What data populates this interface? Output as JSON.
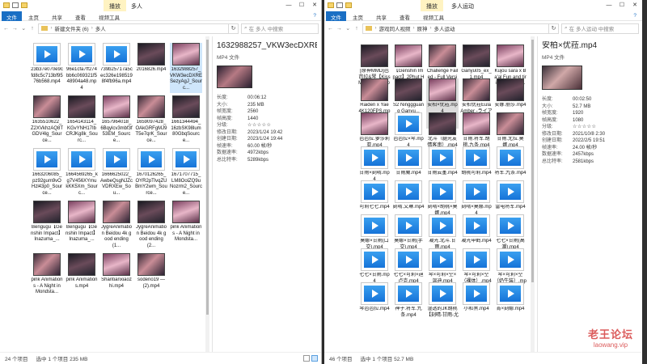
{
  "left_window": {
    "context_tab": "播放",
    "title": "多人",
    "ribbon": [
      "文件",
      "主页",
      "共享",
      "查看",
      "视频工具"
    ],
    "breadcrumb": [
      "新建文件夹 (6)",
      "多人"
    ],
    "search_placeholder": "在 多人 中搜索",
    "files": [
      {
        "name": "23b37e070e9cfd8c5c713bf9576b568.mp4",
        "kind": "video"
      },
      {
        "name": "96e1cfa7ff274bb6c069321f548904a48.mp4",
        "kind": "video"
      },
      {
        "name": "739b25717a5cec326e1985198f4fb96a.mp4",
        "kind": "video"
      },
      {
        "name": "2016826.mp4",
        "kind": "img"
      },
      {
        "name": "1632988257_VKW3ecDXRESezyAgJ_Sourc...",
        "kind": "img",
        "selected": true
      },
      {
        "name": "1635510622_Z2XVkhzAQ8TGDV4lg_Source...",
        "kind": "img"
      },
      {
        "name": "1654143114_KGvYNH17IbCRJKg8k_Sourc...",
        "kind": "img"
      },
      {
        "name": "1657964018_6Bqylcv3mbf3f53EM_Source...",
        "kind": "img"
      },
      {
        "name": "1659097428_OAkGRFgMJ9T5e7qrK_Source...",
        "kind": "img"
      },
      {
        "name": "1661344494_16zbSK98lum80GbqSource...",
        "kind": "img"
      },
      {
        "name": "1663206085_pz92gum9vOHzl43p0_Source...",
        "kind": "video"
      },
      {
        "name": "1664569265_kg7V456XYmukKK5Xm_Sourc...",
        "kind": "video"
      },
      {
        "name": "1666625022_AwbeQsgNJZcVDRXEw_Sou...",
        "kind": "video"
      },
      {
        "name": "1670126265_OYR2pTlvqZUBmY2wm_Source...",
        "kind": "video"
      },
      {
        "name": "1671707715_LM8OolZQ9uNozrm2_Source...",
        "kind": "video"
      },
      {
        "name": "Bengugu【Genshin Impact】Inazuma_...",
        "kind": "img"
      },
      {
        "name": "Bengugu【Genshin Impact】Inazuma_...",
        "kind": "img"
      },
      {
        "name": "JygreAnimation Beidou 4k good ending (1...",
        "kind": "img"
      },
      {
        "name": "JygreAnimation Beidou 4k good ending (2...",
        "kind": "img"
      },
      {
        "name": "pink Animations - A Night in Mondsta...",
        "kind": "img"
      },
      {
        "name": "pink Animations - A Night in Mondsta...",
        "kind": "img"
      },
      {
        "name": "pink Animations.mp4",
        "kind": "img"
      },
      {
        "name": "Shantianxiaozhi.mp4",
        "kind": "img"
      },
      {
        "name": "sodeno19 — (2).mp4",
        "kind": "img"
      }
    ],
    "preview": {
      "title": "1632988257_VKW3ecDXRE...",
      "type": "MP4 文件",
      "props": [
        {
          "k": "长度:",
          "v": "00:06:12"
        },
        {
          "k": "大小:",
          "v": "235 MB"
        },
        {
          "k": "帧宽度:",
          "v": "2560"
        },
        {
          "k": "帧高度:",
          "v": "1440"
        },
        {
          "k": "分级:",
          "v": "☆☆☆☆☆"
        },
        {
          "k": "修改日期:",
          "v": "2023/1/24 19:42"
        },
        {
          "k": "创建日期:",
          "v": "2023/1/24 19:44"
        },
        {
          "k": "帧速率:",
          "v": "60.00 帧/秒"
        },
        {
          "k": "数据速率:",
          "v": "4972kbps"
        },
        {
          "k": "总比特率:",
          "v": "5289kbps"
        }
      ]
    },
    "status": {
      "count": "24 个项目",
      "selected": "选中 1 个项目  235 MB"
    }
  },
  "right_window": {
    "context_tab": "播放",
    "title": "多人运动",
    "ribbon": [
      "文件",
      "主页",
      "共享",
      "查看",
      "视频工具"
    ],
    "breadcrumb": [
      "游戏同人视频",
      "原神",
      "多人运动"
    ],
    "search_placeholder": "在 多人运动 中搜索",
    "files": [
      {
        "name": "[原神MMD]芭芭拉&琴【KissMe爱して るって】",
        "kind": "img"
      },
      {
        "name": "【Genshin Impact】2Phut Hon_4K...",
        "kind": "img"
      },
      {
        "name": "Challenge Failed - Full Version_...",
        "kind": "img"
      },
      {
        "name": "Ganyu05_ex_1.mp4",
        "kind": "img"
      },
      {
        "name": "Kujou sara x Ba'al Fun and tiring gift (HD)...",
        "kind": "img"
      },
      {
        "name": "Raiden x Yae 4K120FPS.mp4",
        "kind": "img"
      },
      {
        "name": "S2 Ninggguang Ganyu...",
        "kind": "img"
      },
      {
        "name": "安柏×优菈.mp4",
        "kind": "img",
        "selected": true
      },
      {
        "name": "安柏优菈Eula Amber -ライアーダ...",
        "kind": "img"
      },
      {
        "name": "安娜.丽莎.mp4",
        "kind": "img"
      },
      {
        "name": "芭芭拉.萝莎莉亚.mp4",
        "kind": "img"
      },
      {
        "name": "芭芭拉×琴.mp4",
        "kind": "video"
      },
      {
        "name": "北斗（腿光友情客串）.mp4",
        "kind": "img"
      },
      {
        "name": "甘雨.将军.胡桃.九条.mp4",
        "kind": "img"
      },
      {
        "name": "甘雨.尤拉.莫娜.mp4",
        "kind": "img"
      },
      {
        "name": "甘雨×刻晴.mp4",
        "kind": "video"
      },
      {
        "name": "甘雨魔.mp4",
        "kind": "video"
      },
      {
        "name": "甘雨云堇.mp4",
        "kind": "video"
      },
      {
        "name": "胡桃可莉.mp4",
        "kind": "video"
      },
      {
        "name": "将军.九条.mp4",
        "kind": "video"
      },
      {
        "name": "可莉七七.mp4",
        "kind": "video"
      },
      {
        "name": "刻晴.又琳.mp4",
        "kind": "video"
      },
      {
        "name": "刻晴×胡桃×莫娜.mp4",
        "kind": "video"
      },
      {
        "name": "刻晴×莫娜.mp4",
        "kind": "video"
      },
      {
        "name": "雷电将军.mp4",
        "kind": "video"
      },
      {
        "name": "莫娜×甘雨(口交).mp4",
        "kind": "video"
      },
      {
        "name": "莫娜×甘雨(手交).mp4",
        "kind": "video"
      },
      {
        "name": "凝光.北斗.甘雨.mp4",
        "kind": "video"
      },
      {
        "name": "凝光申鹤.mp4",
        "kind": "video"
      },
      {
        "name": "七七×甘雨(高潮).mp4",
        "kind": "video"
      },
      {
        "name": "七七×甘雨.mp4",
        "kind": "video"
      },
      {
        "name": "七七×可莉×迪卢克.mp4",
        "kind": "video"
      },
      {
        "name": "琴×可莉×空×温迪.mp4",
        "kind": "video"
      },
      {
        "name": "琴×可莉×空（裸体）.mp4",
        "kind": "video"
      },
      {
        "name": "琴×可莉×空（奶牛装）.mp4",
        "kind": "video"
      },
      {
        "name": "琴芭芭拉.mp4",
        "kind": "video"
      },
      {
        "name": "神子.将军.九条.mp4",
        "kind": "video"
      },
      {
        "name": "湿透的JK胡桃【刻晴-甘雨-尤",
        "kind": "video"
      },
      {
        "name": "小和黑.mp4",
        "kind": "video"
      },
      {
        "name": "宵×刻娜.mp4",
        "kind": "video"
      }
    ],
    "preview": {
      "title": "安柏×优菈.mp4",
      "type": "MP4 文件",
      "props": [
        {
          "k": "长度:",
          "v": "00:02:50"
        },
        {
          "k": "大小:",
          "v": "52.7 MB"
        },
        {
          "k": "帧宽度:",
          "v": "1920"
        },
        {
          "k": "帧高度:",
          "v": "1080"
        },
        {
          "k": "分级:",
          "v": "☆☆☆☆☆"
        },
        {
          "k": "修改日期:",
          "v": "2021/10/8 2:30"
        },
        {
          "k": "创建日期:",
          "v": "2022/2/5 19:51"
        },
        {
          "k": "帧速率:",
          "v": "24.00 帧/秒"
        },
        {
          "k": "数据速率:",
          "v": "2457kbps"
        },
        {
          "k": "总比特率:",
          "v": "2581kbps"
        }
      ]
    },
    "status": {
      "count": "46 个项目",
      "selected": "选中 1 个项目  52.7 MB"
    }
  },
  "watermark": {
    "line1": "老王论坛",
    "line2": "laowang.vip"
  }
}
